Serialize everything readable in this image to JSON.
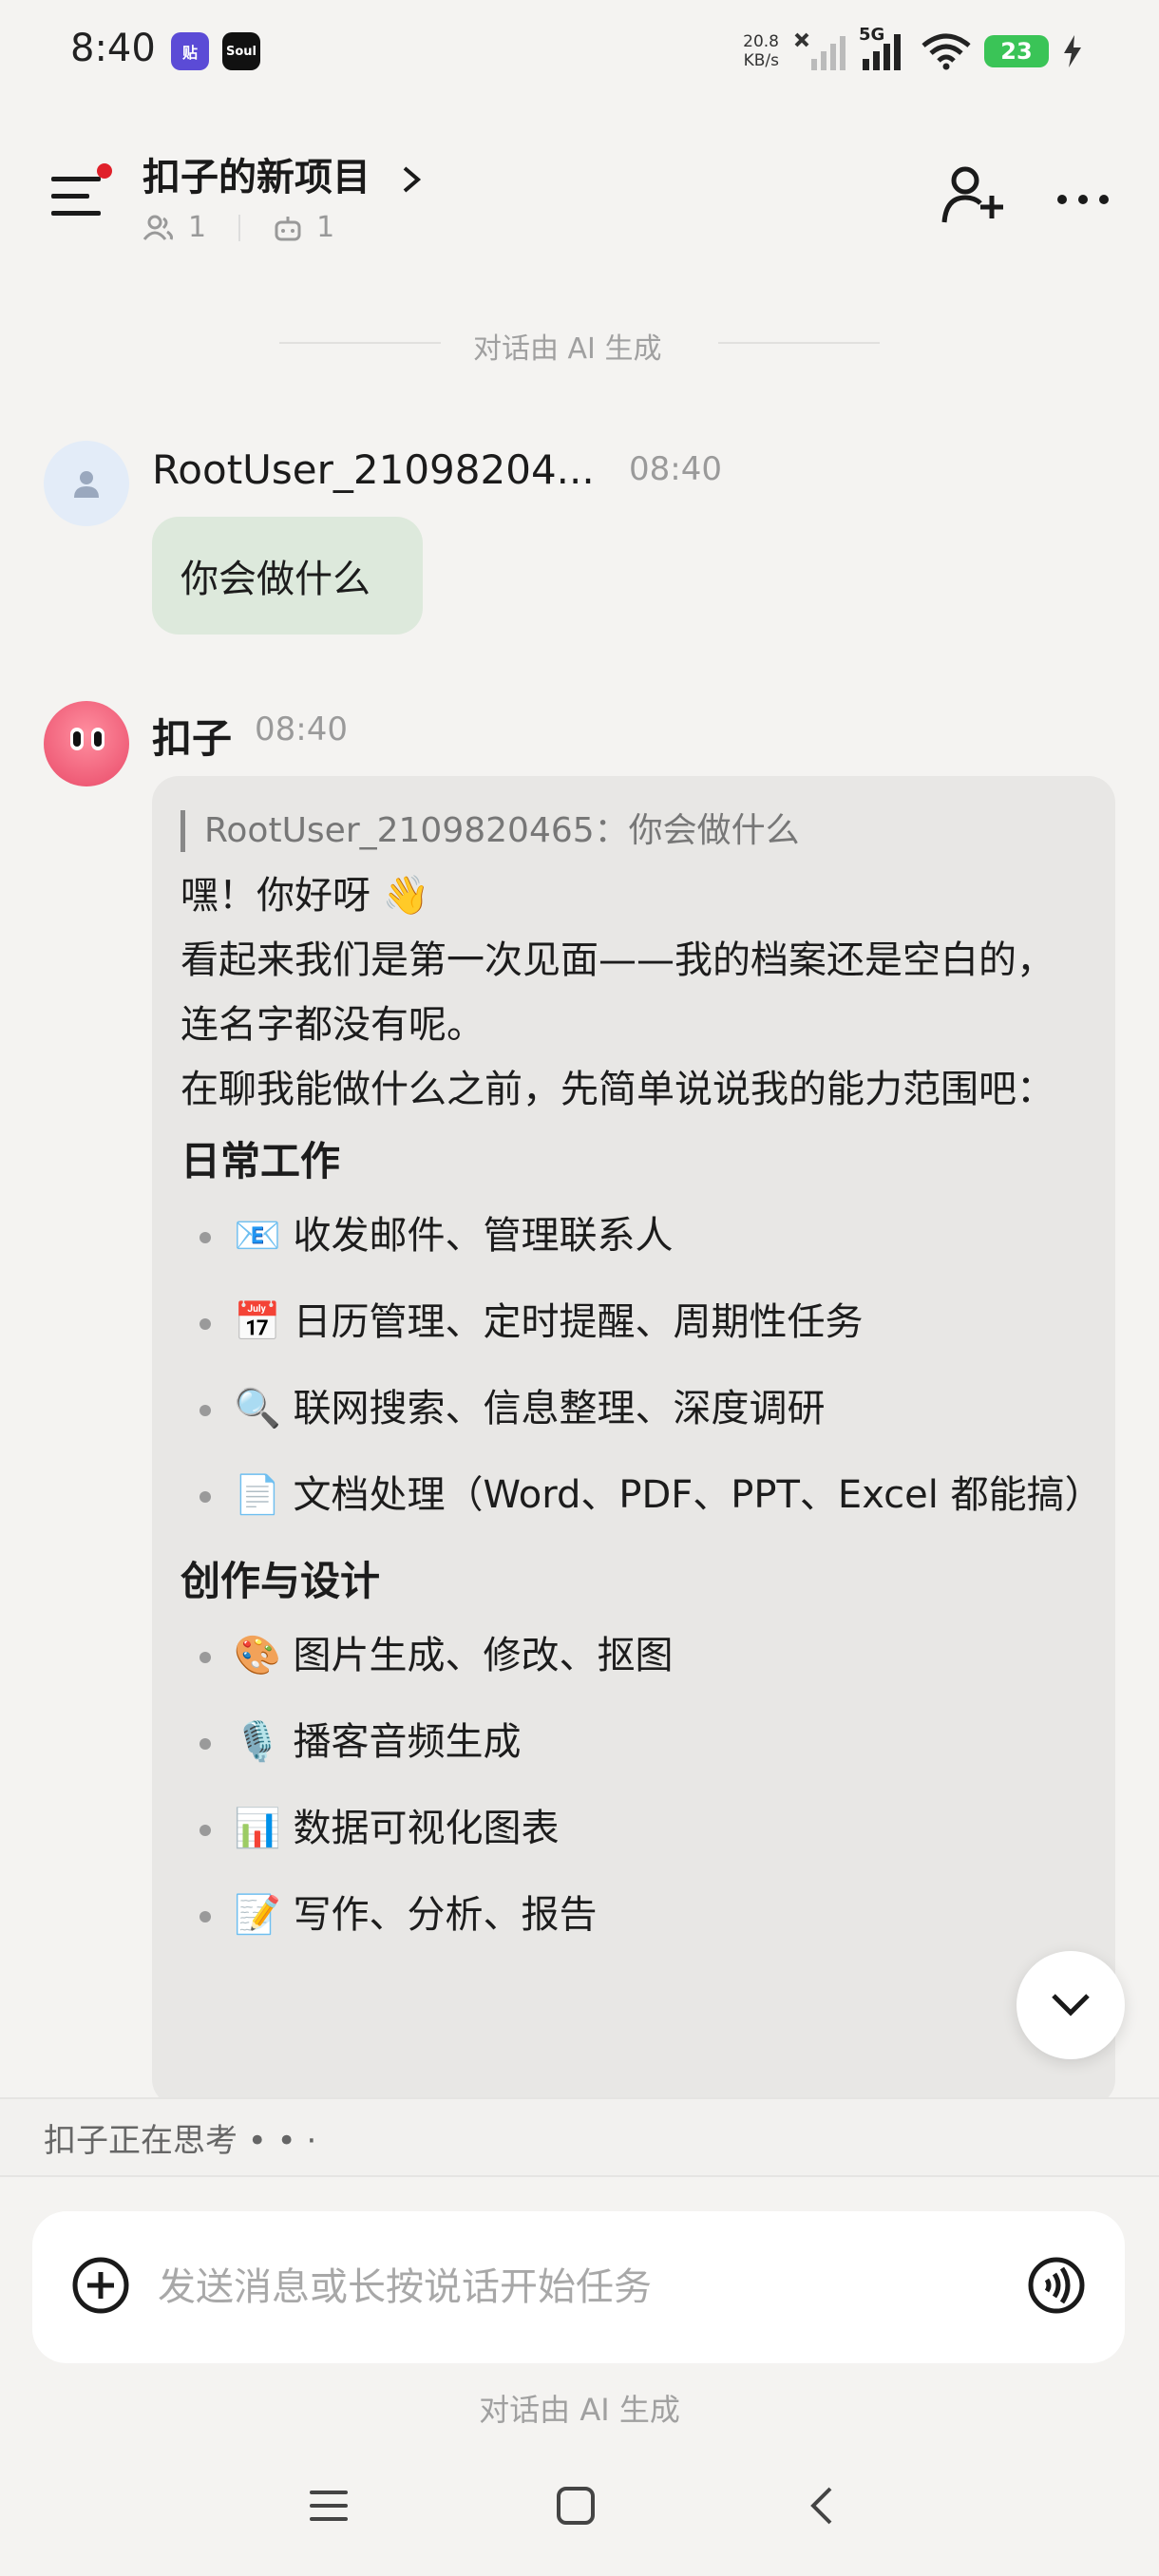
{
  "status_bar": {
    "time": "8:40",
    "app1_label": "贴",
    "app2_label": "Soul",
    "net_speed_value": "20.8",
    "net_speed_unit": "KB/s",
    "network": "5G",
    "battery": "23"
  },
  "header": {
    "title": "扣子的新项目",
    "members_count": "1",
    "bots_count": "1"
  },
  "ai_notice": "对话由 AI 生成",
  "messages": [
    {
      "sender": "RootUser_21098204...",
      "time": "08:40",
      "text": "你会做什么"
    },
    {
      "sender": "扣子",
      "time": "08:40",
      "quote": "RootUser_2109820465：你会做什么",
      "intro": [
        "嘿！你好呀 👋",
        "看起来我们是第一次见面——我的档案还是空白的，连名字都没有呢。",
        "在聊我能做什么之前，先简单说说我的能力范围吧："
      ],
      "sections": [
        {
          "heading": "日常工作",
          "items": [
            "📧 收发邮件、管理联系人",
            "📅 日历管理、定时提醒、周期性任务",
            "🔍 联网搜索、信息整理、深度调研",
            "📄 文档处理（Word、PDF、PPT、Excel 都能搞）"
          ]
        },
        {
          "heading": "创作与设计",
          "items": [
            "🎨 图片生成、修改、抠图",
            "🎙️ 播客音频生成",
            "📊 数据可视化图表",
            "📝 写作、分析、报告"
          ]
        }
      ]
    }
  ],
  "thinking_status": "扣子正在思考 • • ·",
  "composer": {
    "placeholder": "发送消息或长按说话开始任务"
  },
  "bottom_notice": "对话由 AI 生成",
  "colors": {
    "background": "#f4f3f1",
    "user_bubble": "#dde9dc",
    "bot_bubble": "#e8e7e5",
    "notification_dot": "#e0202a",
    "battery": "#3ac457"
  }
}
